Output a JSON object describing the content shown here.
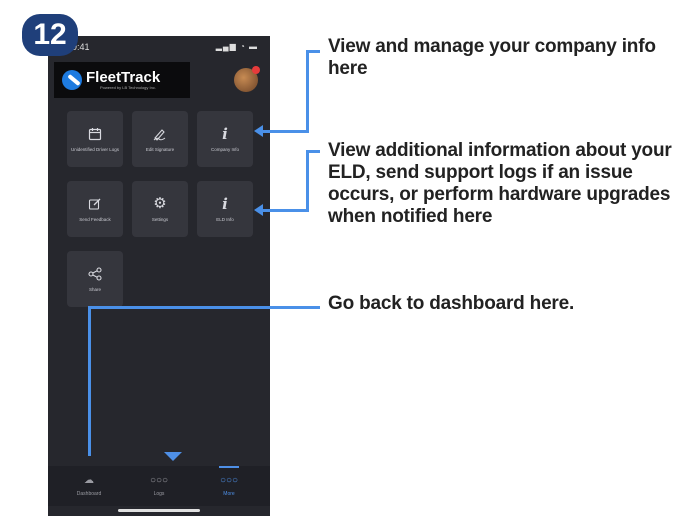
{
  "step_number": "12",
  "phone": {
    "status_time": "9:41",
    "status_icons": "▂▄▆ ◔ ▬",
    "logo": {
      "name": "FleetTrack",
      "tagline": "Powered by LB Technology Inc."
    },
    "tiles": [
      {
        "icon": "calendar-icon",
        "label": "Unidentified Driver Logs"
      },
      {
        "icon": "signature-icon",
        "label": "Edit Signature"
      },
      {
        "icon": "info-icon",
        "label": "Company Info"
      },
      {
        "icon": "feedback-icon",
        "label": "Send Feedback"
      },
      {
        "icon": "gear-icon",
        "label": "Settings"
      },
      {
        "icon": "info-icon",
        "label": "ELD Info"
      },
      {
        "icon": "share-icon",
        "label": "Share"
      }
    ],
    "nav": [
      {
        "icon": "cloud-icon",
        "label": "Dashboard"
      },
      {
        "icon": "dots-icon",
        "label": "Logs"
      },
      {
        "icon": "dots-icon",
        "label": "More"
      }
    ]
  },
  "annotations": {
    "company_info": "View and manage your company info here",
    "eld_info": "View additional information about your ELD, send support logs if an issue occurs, or perform hardware upgrades when notified here",
    "dashboard": "Go back to dashboard here."
  },
  "colors": {
    "accent": "#4a90e8",
    "badge": "#1f3f7a",
    "phone_bg": "#26272d",
    "tile_bg": "#35363d"
  }
}
